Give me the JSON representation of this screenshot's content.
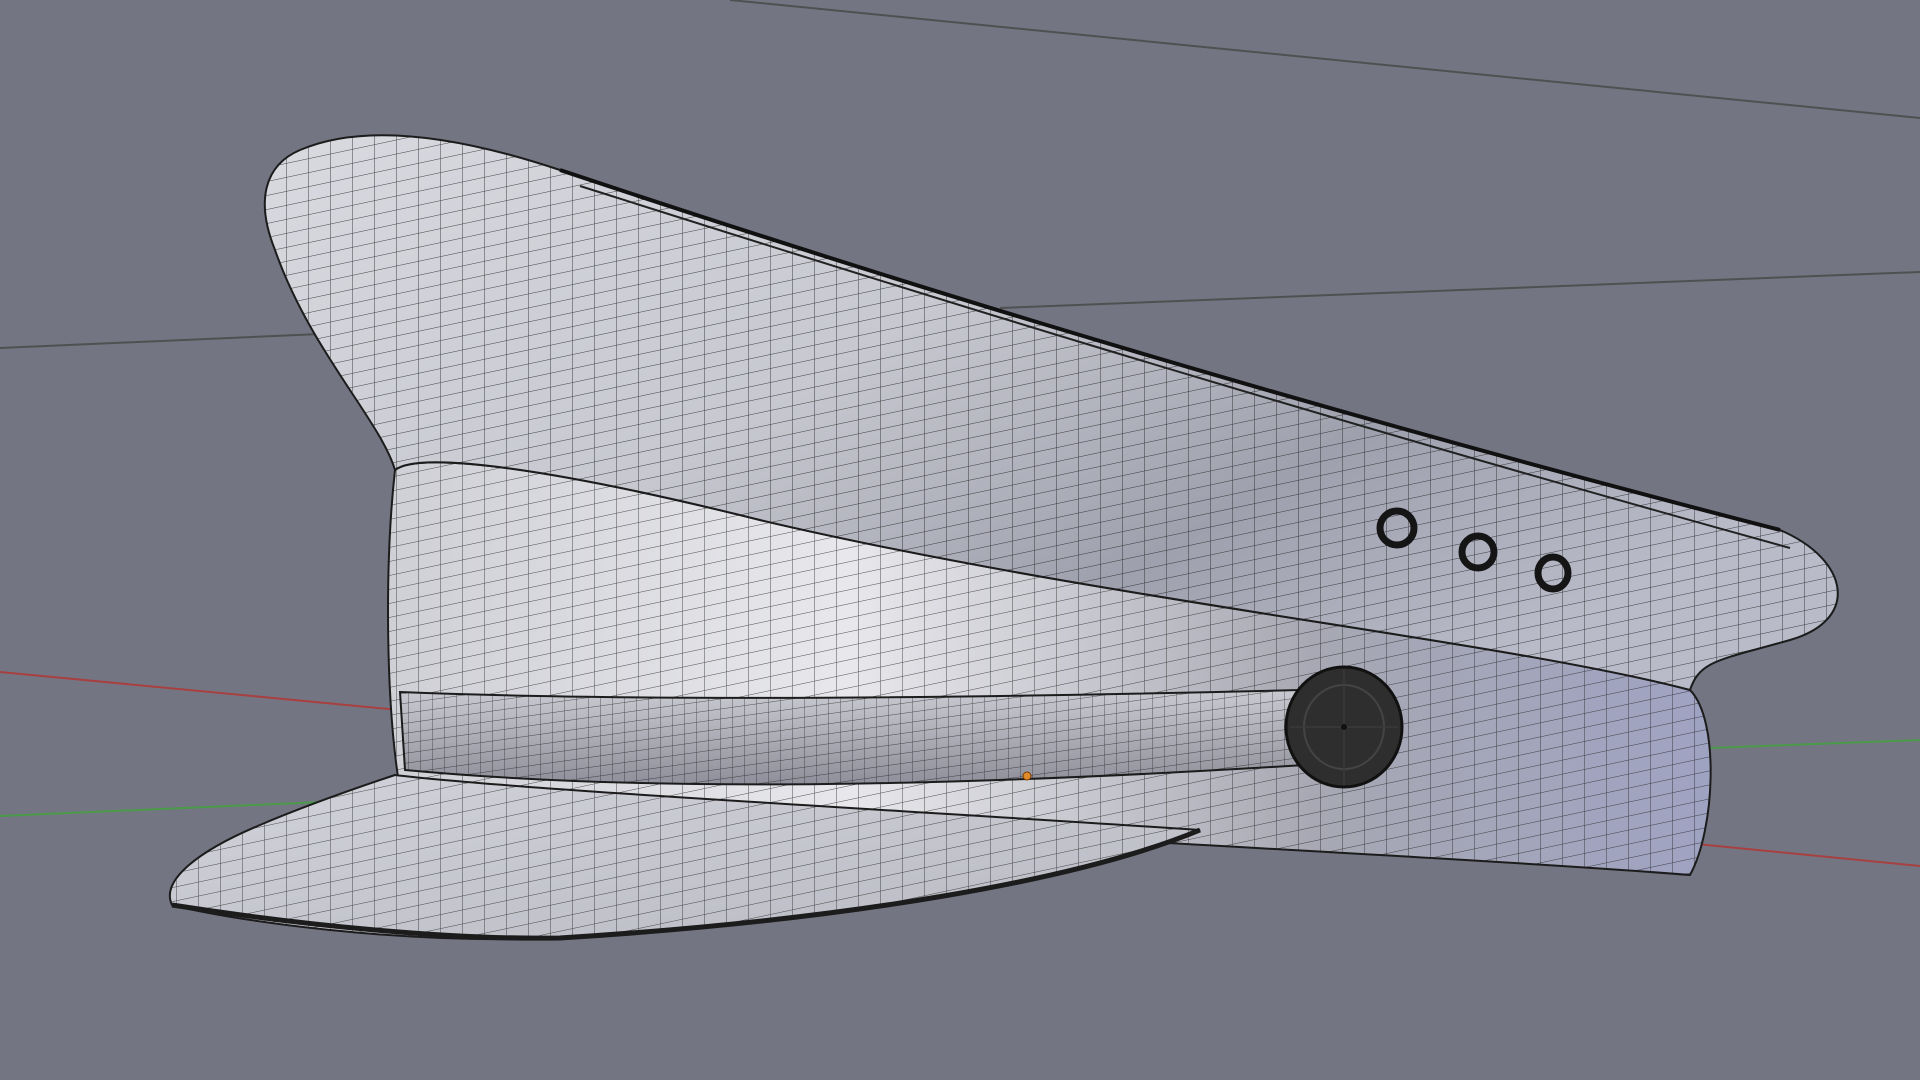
{
  "viewport": {
    "background_color": "#737583",
    "mode": "3d-wireframe-overlay",
    "object": "peaked-cap-mesh"
  },
  "colors": {
    "axis_x": "#a84040",
    "axis_y": "#4a9a4a",
    "grid_line": "#4f5150",
    "mesh_wire": "#1c1c1c",
    "surface_light": "#d7d8de",
    "surface_mid": "#a6a8b5",
    "surface_dark": "#6f7080",
    "origin_dot": "#e08a2a",
    "button": "#2e2e2e"
  },
  "icons": {
    "object_origin": "origin-dot-icon"
  }
}
